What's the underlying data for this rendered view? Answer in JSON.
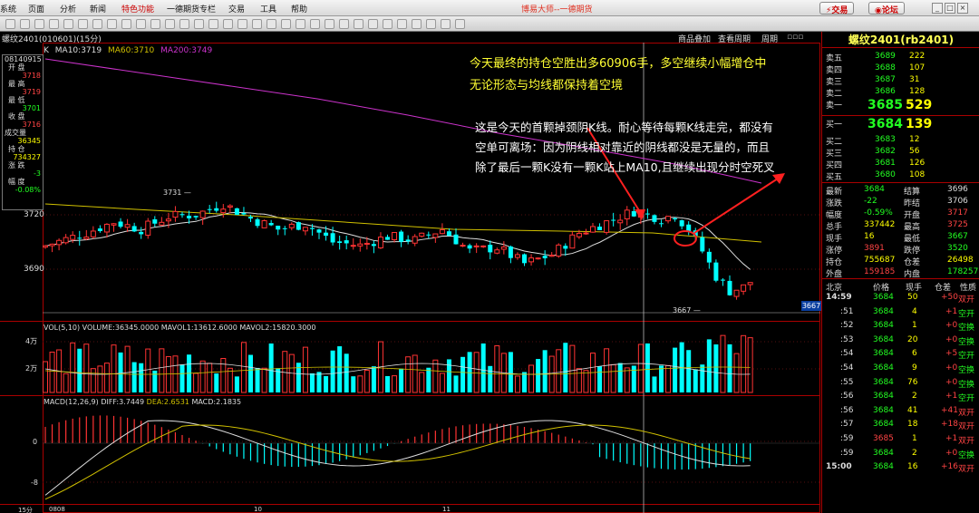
{
  "menubar": {
    "items": [
      "系统",
      "页面",
      "分析",
      "新闻",
      "特色功能",
      "一德期货专栏",
      "交易",
      "工具",
      "帮助"
    ],
    "active_index": 4,
    "title": "博易大师--一德期货",
    "trade_btn": "交易",
    "forum_btn": "论坛"
  },
  "chart": {
    "symbol_header": "螺纹2401(010601)(15分)",
    "links": [
      "商品叠加",
      "查看周期",
      "周期"
    ],
    "ma_label": "K",
    "ma10": "MA10:3719",
    "ma60": "MA60:3710",
    "ma200": "MA200:3749",
    "price_labels": [
      "3720",
      "3690"
    ],
    "high_mark": "3731",
    "low_mark": "3667",
    "last_tag": "3667",
    "vol_header": "VOL(5,10) VOLUME:36345.0000 MAVOL1:13612.6000 MAVOL2:15820.3000",
    "vol_ticks": [
      "4万",
      "2万"
    ],
    "macd_header_prefix": "MACD(12,26,9)",
    "macd_diff": "DIFF:3.7449",
    "macd_dea": "DEA:2.6531",
    "macd_macd": "MACD:2.1835",
    "macd_ticks": [
      "0",
      "-8"
    ],
    "x_labels": [
      "15分",
      "0808",
      "10",
      "11"
    ],
    "colors": {
      "up": "#ff3333",
      "down": "#00ffff",
      "ma10": "#dddddd",
      "ma60": "#d0c000",
      "ma200": "#cc33cc",
      "arrow": "#ff2020"
    }
  },
  "info": {
    "time": "08140915",
    "rows": [
      {
        "label": "开 盘",
        "value": "3718",
        "color": "r"
      },
      {
        "label": "最 高",
        "value": "3719",
        "color": "r"
      },
      {
        "label": "最 低",
        "value": "3701",
        "color": "g"
      },
      {
        "label": "收 盘",
        "value": "3716",
        "color": "r"
      },
      {
        "label": "成交量",
        "value": "36345",
        "color": "y"
      },
      {
        "label": "持 仓",
        "value": "734327",
        "color": "y"
      },
      {
        "label": "涨 跌",
        "value": "-3",
        "color": "g"
      },
      {
        "label": "幅 度",
        "value": "-0.08%",
        "color": "g"
      }
    ]
  },
  "annotations": {
    "line1": "今天最终的持仓空胜出多60906手，多空继续小幅增仓中",
    "line2": "无论形态与均线都保持着空境",
    "line3": "这是今天的首颗掉颈阴K线。耐心等待每颗K线走完，都没有",
    "line4": "空单可离场：因为阴线相对靠近的阴线都没是无量的，而且",
    "line5": "除了最后一颗K没有一颗K站上MA10,且继续出现分时空死叉"
  },
  "quote": {
    "title": "螺纹2401(rb2401)",
    "asks": [
      {
        "label": "卖五",
        "price": "3689",
        "vol": "222"
      },
      {
        "label": "卖四",
        "price": "3688",
        "vol": "107"
      },
      {
        "label": "卖三",
        "price": "3687",
        "vol": "31"
      },
      {
        "label": "卖二",
        "price": "3686",
        "vol": "128"
      }
    ],
    "ask1": {
      "label": "卖一",
      "price": "3685",
      "vol": "529"
    },
    "bid1": {
      "label": "买一",
      "price": "3684",
      "vol": "139"
    },
    "bids": [
      {
        "label": "买二",
        "price": "3683",
        "vol": "12"
      },
      {
        "label": "买三",
        "price": "3682",
        "vol": "56"
      },
      {
        "label": "买四",
        "price": "3681",
        "vol": "126"
      },
      {
        "label": "买五",
        "price": "3680",
        "vol": "108"
      }
    ],
    "stats": [
      {
        "l1": "最新",
        "v1": "3684",
        "c1": "g",
        "l2": "结算",
        "v2": "3696",
        "c2": "w"
      },
      {
        "l1": "涨跌",
        "v1": "-22",
        "c1": "g",
        "l2": "昨结",
        "v2": "3706",
        "c2": "w"
      },
      {
        "l1": "幅度",
        "v1": "-0.59%",
        "c1": "g",
        "l2": "开盘",
        "v2": "3717",
        "c2": "r"
      },
      {
        "l1": "总手",
        "v1": "337442",
        "c1": "y",
        "l2": "最高",
        "v2": "3725",
        "c2": "r"
      },
      {
        "l1": "现手",
        "v1": "16",
        "c1": "y",
        "l2": "最低",
        "v2": "3667",
        "c2": "g"
      },
      {
        "l1": "涨停",
        "v1": "3891",
        "c1": "r",
        "l2": "跌停",
        "v2": "3520",
        "c2": "g"
      },
      {
        "l1": "持仓",
        "v1": "755687",
        "c1": "y",
        "l2": "仓差",
        "v2": "26498",
        "c2": "y"
      },
      {
        "l1": "外盘",
        "v1": "159185",
        "c1": "r",
        "l2": "内盘",
        "v2": "178257",
        "c2": "g"
      }
    ],
    "tick_header": [
      "北京",
      "价格",
      "现手",
      "仓差",
      "性质"
    ],
    "ticks": [
      {
        "t": "14:59",
        "p": "3684",
        "v": "50",
        "d": "+50",
        "n": "双开",
        "nc": "r"
      },
      {
        "t": ":51",
        "p": "3684",
        "v": "4",
        "d": "+1",
        "n": "空开",
        "nc": "g"
      },
      {
        "t": ":52",
        "p": "3684",
        "v": "1",
        "d": "+0",
        "n": "空换",
        "nc": "g"
      },
      {
        "t": ":53",
        "p": "3684",
        "v": "20",
        "d": "+0",
        "n": "空换",
        "nc": "g"
      },
      {
        "t": ":54",
        "p": "3684",
        "v": "6",
        "d": "+5",
        "n": "空开",
        "nc": "g"
      },
      {
        "t": ":54",
        "p": "3684",
        "v": "9",
        "d": "+0",
        "n": "空换",
        "nc": "g"
      },
      {
        "t": ":55",
        "p": "3684",
        "v": "76",
        "d": "+0",
        "n": "空换",
        "nc": "g"
      },
      {
        "t": ":56",
        "p": "3684",
        "v": "2",
        "d": "+1",
        "n": "空开",
        "nc": "g"
      },
      {
        "t": ":56",
        "p": "3684",
        "v": "41",
        "d": "+41",
        "n": "双开",
        "nc": "r"
      },
      {
        "t": ":57",
        "p": "3684",
        "v": "18",
        "d": "+18",
        "n": "双开",
        "nc": "r"
      },
      {
        "t": ":59",
        "p": "3685",
        "v": "1",
        "d": "+1",
        "n": "双开",
        "nc": "r"
      },
      {
        "t": ":59",
        "p": "3684",
        "v": "2",
        "d": "+0",
        "n": "空换",
        "nc": "g"
      },
      {
        "t": "15:00",
        "p": "3684",
        "v": "16",
        "d": "+16",
        "n": "双开",
        "nc": "r"
      }
    ]
  }
}
